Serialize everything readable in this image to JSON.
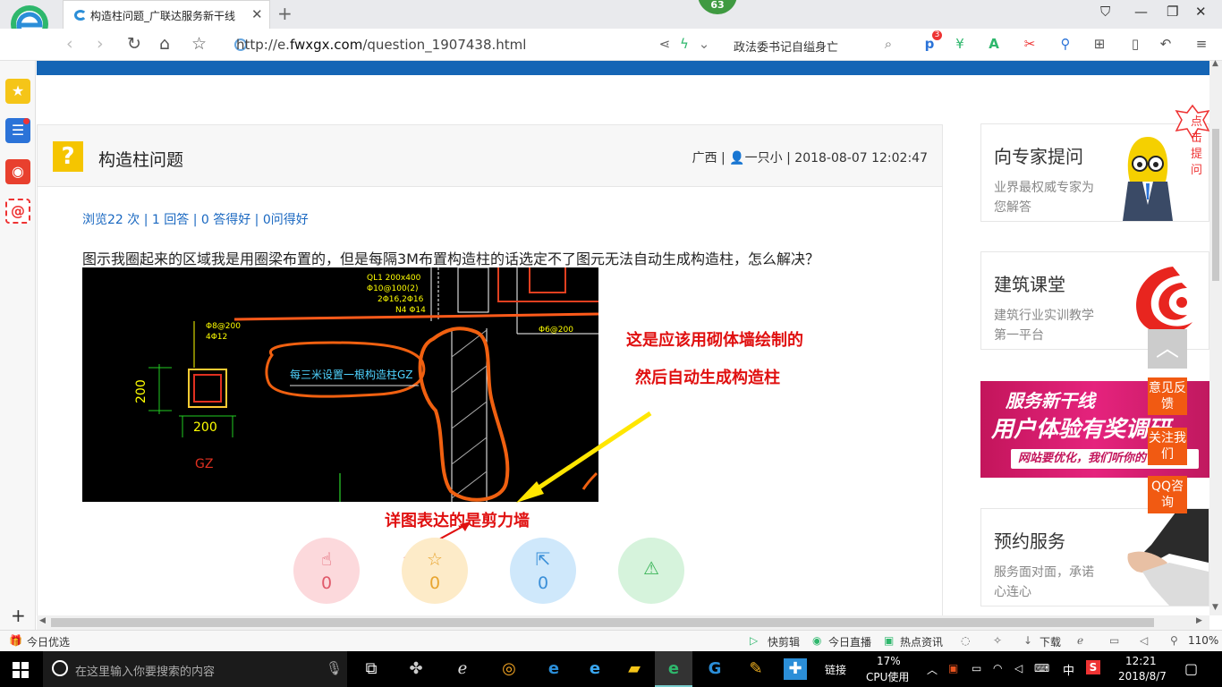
{
  "browser": {
    "tab_title": "构造柱问题_广联达服务新干线",
    "tab_close": "✕",
    "new_tab": "+",
    "badge": "63",
    "url_prefix": "http://e.",
    "url_domain": "fwxgx.com",
    "url_path": "/question_1907438.html",
    "search_text": "政法委书记自缢身亡",
    "ext_badge": "3"
  },
  "question": {
    "icon": "?",
    "title": "构造柱问题",
    "region": "广西",
    "author": "一只小",
    "datetime": "2018-08-07 12:02:47",
    "stats": "浏览22 次 | 1 回答 | 0 答得好 | 0问得好",
    "body": "图示我圈起来的区域我是用圈梁布置的，但是每隔3M布置构造柱的话选定不了图元无法自动生成构造柱，怎么解决？"
  },
  "cad": {
    "labels": [
      "QL1 200x400",
      "Φ10@100(2)",
      "2Φ16,2Φ16",
      "N4 Φ14",
      "Φ8@200",
      "4Φ12",
      "200",
      "200",
      "GZ",
      "每三米设置一根构造柱GZ",
      "Φ6@200"
    ]
  },
  "annotations": {
    "line1": "这是应该用砌体墙绘制的",
    "line2": "然后自动生成构造柱",
    "line3": "详图表达的是剪力墙"
  },
  "actions": [
    {
      "icon": "thumbs-up",
      "count": "0"
    },
    {
      "icon": "star",
      "count": "0"
    },
    {
      "icon": "share",
      "count": "0"
    },
    {
      "icon": "warning",
      "count": ""
    }
  ],
  "right": {
    "expert_title": "向专家提问",
    "expert_sub": "业界最权威专家为您解答",
    "expert_bubble": "点击提问",
    "class_title": "建筑课堂",
    "class_sub": "建筑行业实训教学第一平台",
    "banner_l1": "服务新干线",
    "banner_l2": "用户体验有奖调研",
    "banner_l3": "网站要优化，我们听你的",
    "booking_title": "预约服务",
    "booking_sub": "服务面对面，承诺心连心",
    "float_feedback": "意见反馈",
    "float_follow": "关注我们",
    "float_qq": "QQ咨询"
  },
  "statusbar": {
    "today": "今日优选",
    "kuaijianji": "快剪辑",
    "live": "今日直播",
    "hotnews": "热点资讯",
    "download": "下载",
    "zoom": "110%"
  },
  "taskbar": {
    "search_placeholder": "在这里输入你要搜索的内容",
    "link": "链接",
    "cpu_pct": "17%",
    "cpu_label": "CPU使用",
    "ime": "中",
    "time": "12:21",
    "date": "2018/8/7"
  },
  "colors": {
    "accent_blue": "#1565b5",
    "annotation_red": "#e01010",
    "float_orange": "#f15a12",
    "banner_pink": "#e5237d"
  }
}
